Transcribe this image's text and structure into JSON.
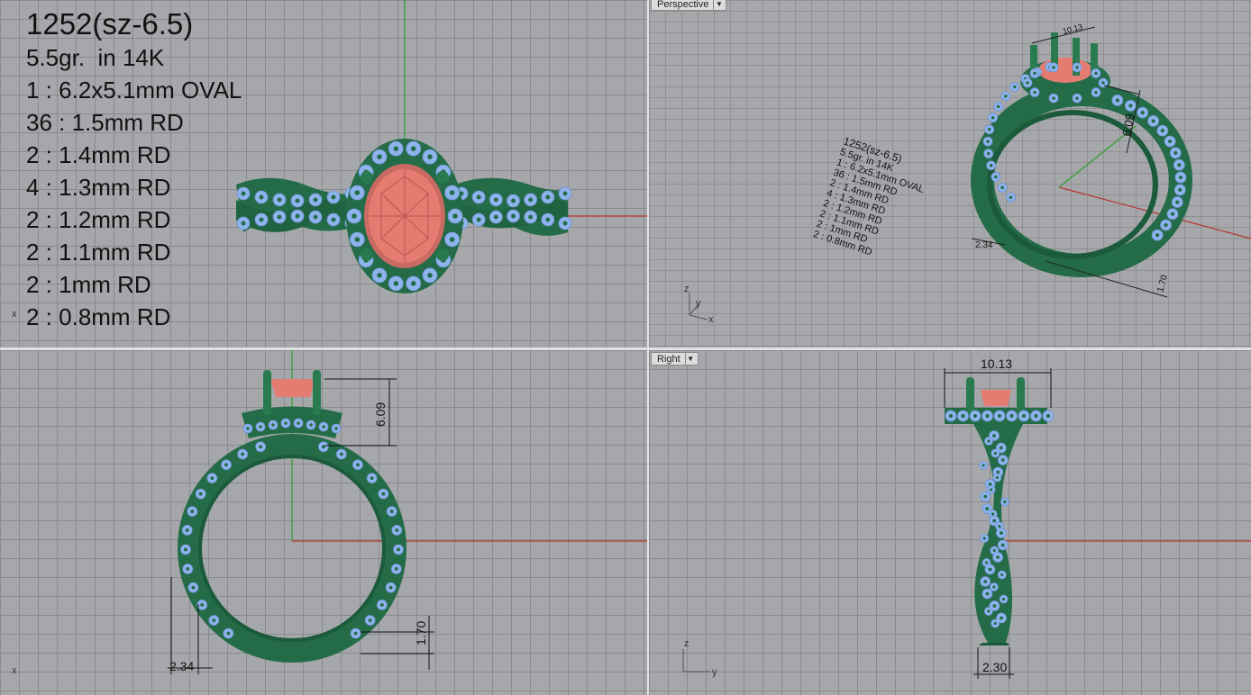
{
  "top_view": {
    "title": "1252(sz-6.5)",
    "lines": [
      "5.5gr.  in 14K",
      "1 : 6.2x5.1mm OVAL",
      "36 : 1.5mm RD",
      "2 : 1.4mm RD",
      "4 : 1.3mm RD",
      "2 : 1.2mm RD",
      "2 : 1.1mm RD",
      "2 : 1mm RD",
      "2 : 0.8mm RD"
    ],
    "axis_x": "x"
  },
  "perspective_view": {
    "label": "Perspective",
    "dims": {
      "width": "10.13",
      "height": "6.09",
      "shank_width": "2.34",
      "shank_thickness": "1.70"
    },
    "axes": {
      "z": "z",
      "y": "y",
      "x": "x"
    }
  },
  "front_view": {
    "dims": {
      "height": "6.09",
      "shank_width": "2.34",
      "shank_thickness": "1.70"
    },
    "axis_x": "x"
  },
  "right_view": {
    "label": "Right",
    "dims": {
      "width": "10.13",
      "shank_width": "2.30"
    },
    "axes": {
      "z": "z",
      "y": "y"
    }
  },
  "colors": {
    "metal": "#236c47",
    "stone_small": "#8fb3ec",
    "stone_center": "#e57c72",
    "axis_x": "#b8332d",
    "axis_y": "#2e9e2e",
    "grid": "#a5a7aa"
  },
  "icons": {
    "viewport_menu": "chevron-down-icon"
  }
}
